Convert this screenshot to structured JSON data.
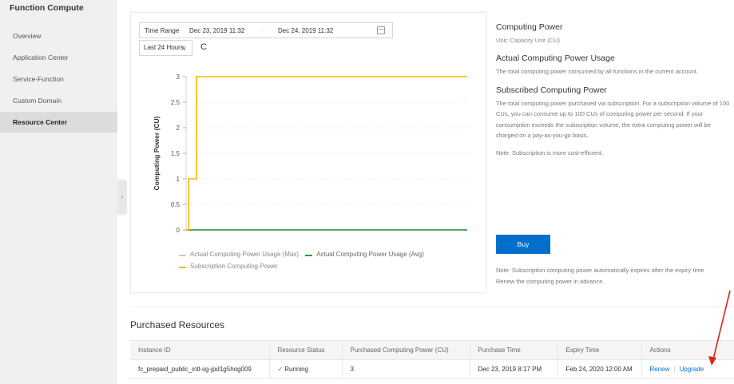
{
  "sidebar": {
    "title": "Function Compute",
    "items": [
      {
        "label": "Overview"
      },
      {
        "label": "Application Center"
      },
      {
        "label": "Service-Function"
      },
      {
        "label": "Custom Domain"
      },
      {
        "label": "Resource Center",
        "active": true
      }
    ]
  },
  "time_range": {
    "label": "Time Range",
    "start": "Dec 23, 2019 11:32",
    "separator": "-",
    "end": "Dec 24, 2019 11:32",
    "preset": "Last  24 Hours"
  },
  "chart_data": {
    "type": "line",
    "ylabel": "Computing Power  (CU)",
    "xlabel": "",
    "ylim": [
      0,
      3
    ],
    "yticks": [
      "0",
      "0.5",
      "1",
      "1.5",
      "2",
      "2.5",
      "3"
    ],
    "x": [
      0,
      0.5,
      1,
      1.5,
      2,
      2.5,
      3,
      4,
      24
    ],
    "series": [
      {
        "name": "Actual Computing Power Usage (Max)",
        "color": "#c8c8c8",
        "values": [
          0,
          0,
          0,
          0,
          0,
          0,
          0,
          0,
          0
        ]
      },
      {
        "name": "Actual Computing Power Usage (Avg)",
        "color": "#1e9e3a",
        "values": [
          0,
          0,
          0,
          0,
          0,
          0,
          0,
          0,
          0
        ]
      },
      {
        "name": "Subscription Computing Power",
        "color": "#f5b700",
        "values": [
          0,
          1,
          1,
          1,
          3,
          3,
          3,
          3,
          3
        ]
      }
    ],
    "grid": true,
    "legend_position": "bottom"
  },
  "info": {
    "title": "Computing Power",
    "unit": "Unit: Capacity Unit (CU)",
    "actual_title": "Actual Computing Power Usage",
    "actual_desc": "The total computing power consumed by all functions in the current account.",
    "sub_title": "Subscribed Computing Power",
    "sub_desc": "The total computing power purchased via subscription. For a subscription volume of 100 CUs, you can consume up to 100 CUs of computing power per second. If your consumption exceeds the subscription volume, the extra computing power will be charged on a pay-as-you-go basis.",
    "note": "Note: Subscription is more cost-efficient.",
    "buy_label": "Buy",
    "expiry_note_1": "Note: Subscription computing power automatically expires after the expiry time",
    "expiry_note_2": "Renew the computing power in advance."
  },
  "purchased": {
    "title": "Purchased Resources",
    "columns": [
      "Instance ID",
      "Resource Status",
      "Purchased Computing Power (CU)",
      "Purchase Time",
      "Expiry Time",
      "Actions"
    ],
    "rows": [
      {
        "instance_id": "fc_prepaid_public_intl-sg-jpd1g5hog009",
        "status": "Running",
        "power": "3",
        "purchase_time": "Dec 23, 2019 8:17 PM",
        "expiry_time": "Feb 24, 2020 12:00 AM",
        "renew": "Renew",
        "upgrade": "Upgrade"
      }
    ]
  },
  "colors": {
    "accent": "#0070cc",
    "annotation_arrow": "#d9261c",
    "running": "#1e9e3a",
    "subscription_line": "#f5b700"
  }
}
